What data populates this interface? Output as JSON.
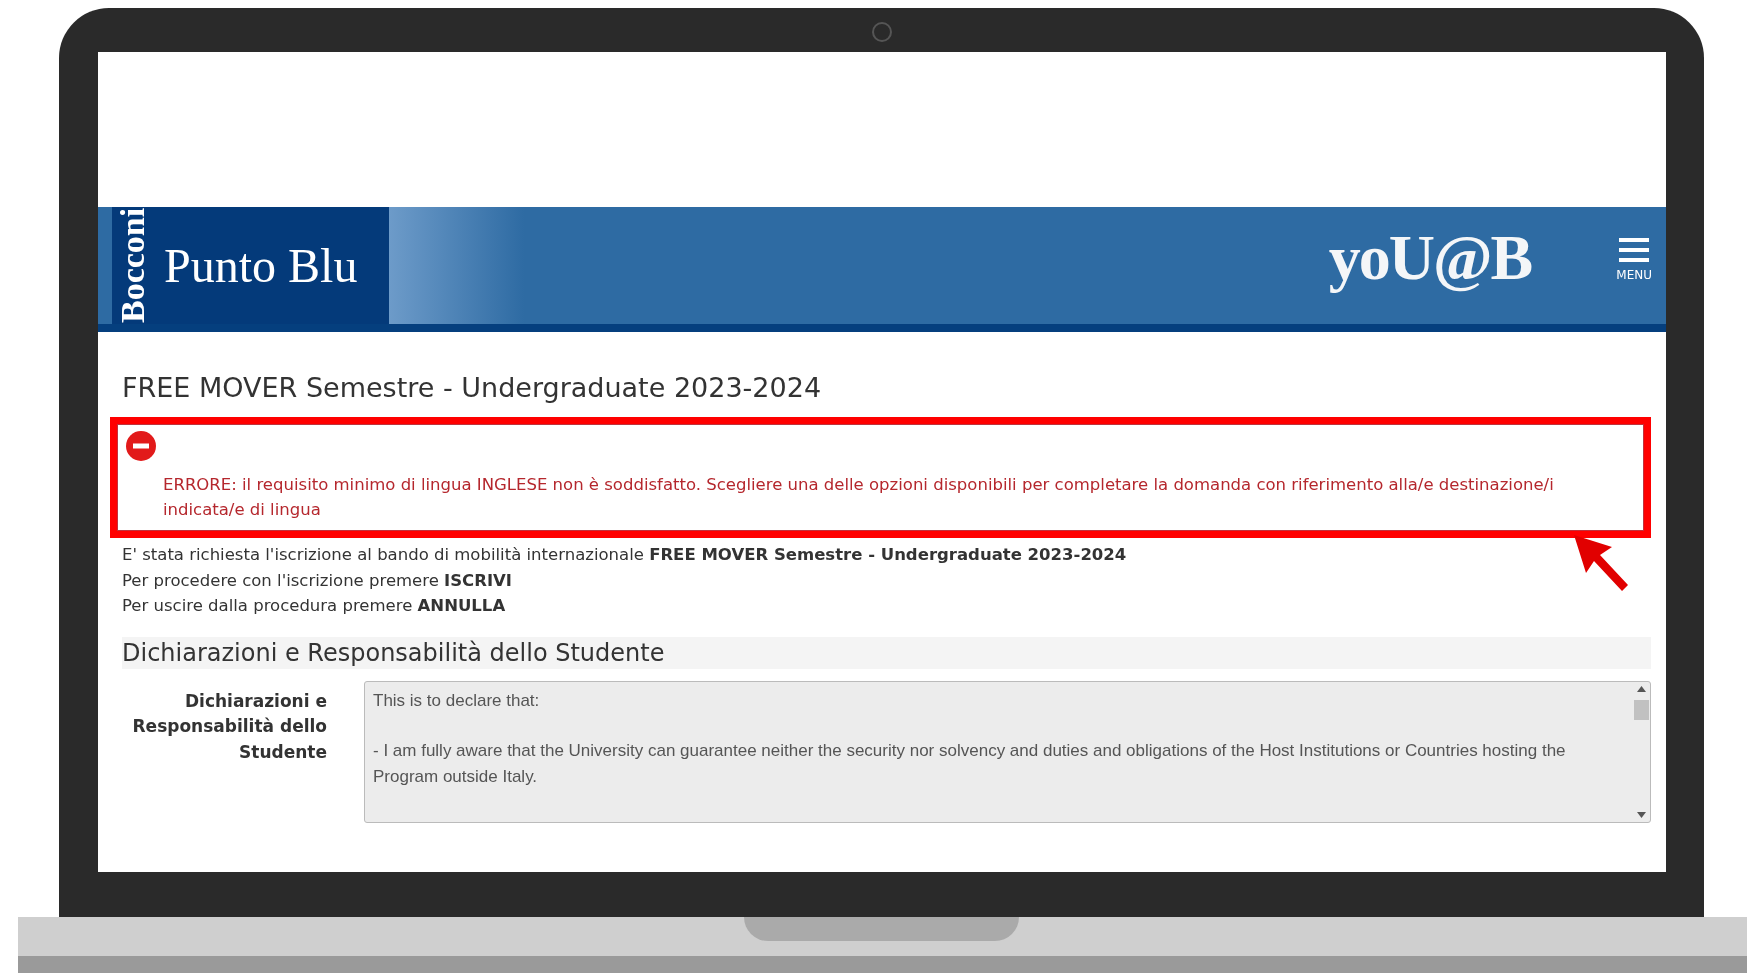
{
  "header": {
    "brand_vertical": "Bocconi",
    "brand": "Punto Blu",
    "logo": "yoU@B",
    "menu_label": "MENU"
  },
  "page_title": "FREE MOVER Semestre - Undergraduate 2023-2024",
  "error": {
    "highlighted": true,
    "message": "ERRORE: il requisito minimo di lingua INGLESE non è soddisfatto. Scegliere una delle opzioni disponibili per completare la domanda con riferimento alla/e destinazione/i indicata/e di lingua"
  },
  "info_lines": [
    "E' stata richiesta l'iscrizione al bando di mobilità  internazionale **FREE MOVER Semestre - Undergraduate 2023-2024**",
    "Per procedere con l'iscrizione premere **ISCRIVI**",
    "Per uscire dalla procedura premere **ANNULLA**"
  ],
  "section": {
    "title": "Dichiarazioni e Responsabilità dello Studente",
    "field_label": "Dichiarazioni e Responsabilità dello Studente",
    "declaration": [
      "This is to declare that:",
      "- I am fully aware that the University can guarantee neither the security nor solvency and duties and obligations of the Host Institutions or Countries hosting the Program outside Italy."
    ]
  }
}
